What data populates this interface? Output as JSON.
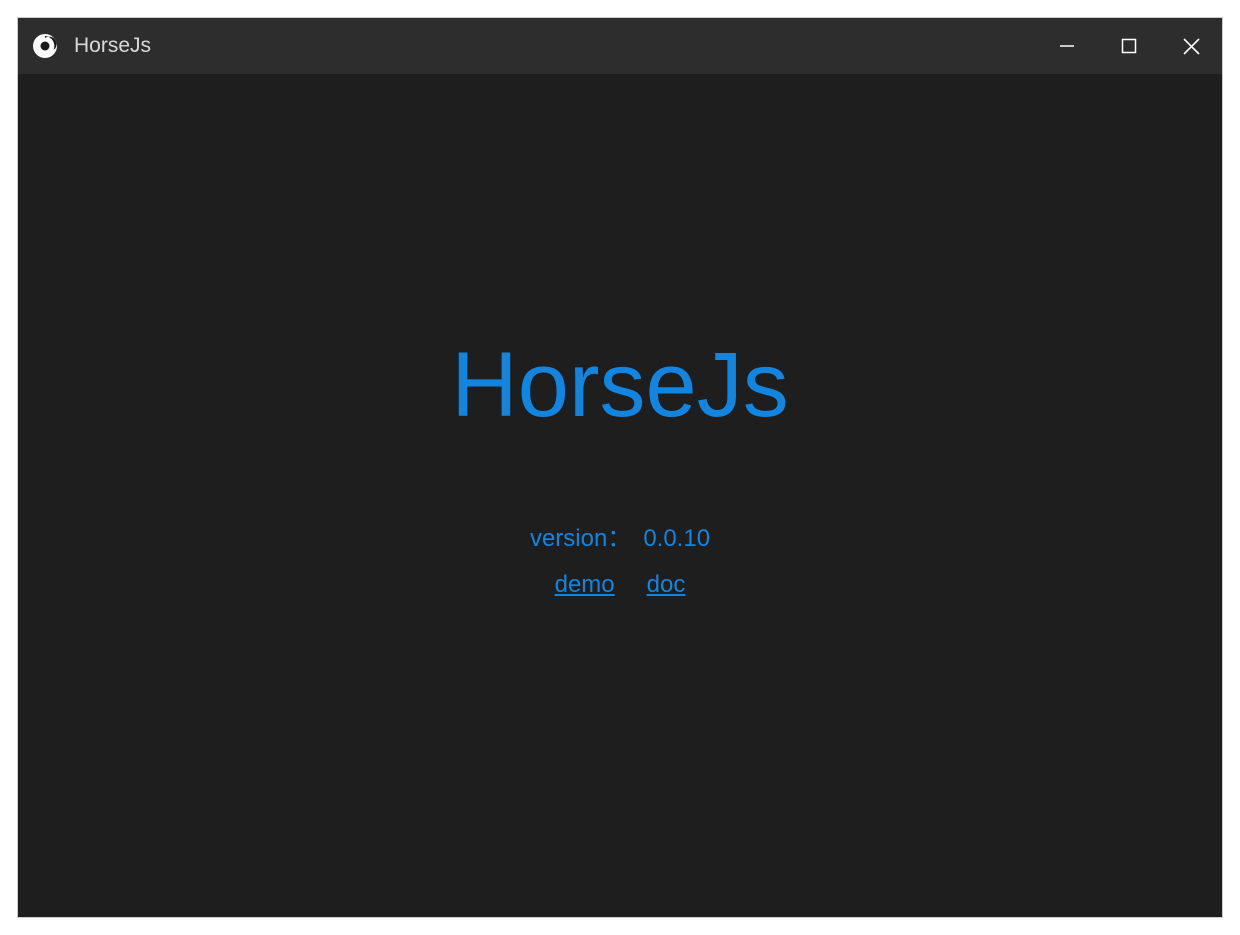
{
  "titlebar": {
    "title": "HorseJs"
  },
  "content": {
    "hero_title": "HorseJs",
    "version_label": "version",
    "version_separator": "：",
    "version_value": "0.0.10",
    "links": {
      "demo": "demo",
      "doc": "doc"
    }
  },
  "colors": {
    "accent": "#1185e0",
    "background": "#1e1e1e",
    "titlebar": "#2d2d2d"
  }
}
